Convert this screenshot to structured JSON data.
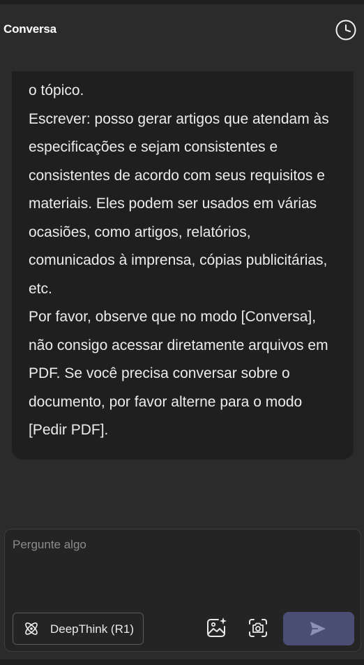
{
  "header": {
    "title": "Conversa",
    "history_icon": "clock-icon"
  },
  "message": {
    "paragraphs": [
      "o tópico.",
      "Escrever: posso gerar artigos que atendam às especificações e sejam consistentes e consistentes de acordo com seus requisitos e materiais. Eles podem ser usados em várias ocasiões, como artigos, relatórios, comunicados à imprensa, cópias publicitárias, etc.",
      "Por favor, observe que no modo [Conversa], não consigo acessar diretamente arquivos em PDF. Se você precisa conversar sobre o documento, por favor alterne para o modo [Pedir PDF]."
    ]
  },
  "composer": {
    "placeholder": "Pergunte algo",
    "value": "",
    "deepthink_label": "DeepThink (R1)",
    "deepthink_icon": "atom-icon",
    "image_button_icon": "image-sparkle-icon",
    "camera_button_icon": "camera-icon",
    "send_button_icon": "send-icon"
  },
  "colors": {
    "background": "#2b2b2b",
    "card": "#1f1f1f",
    "send_button": "#4a4e75"
  }
}
